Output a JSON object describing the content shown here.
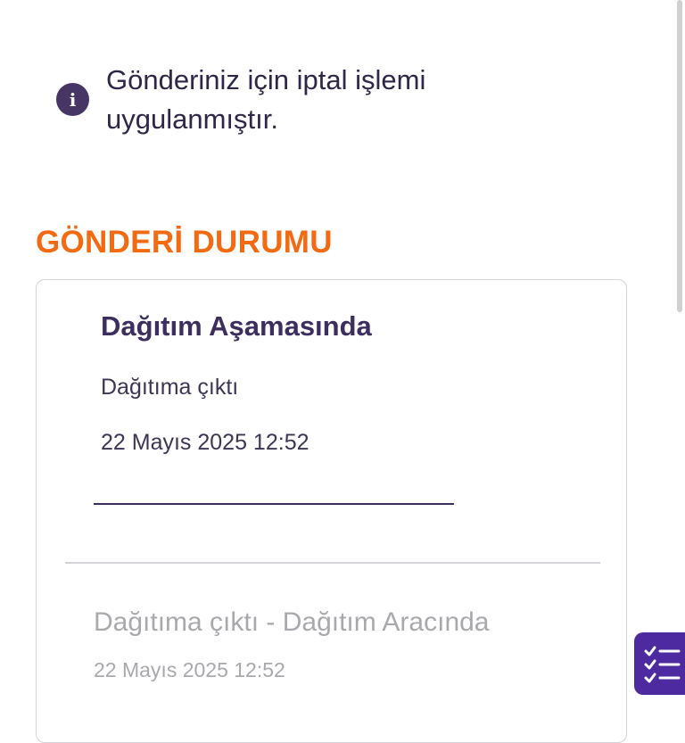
{
  "info_banner": {
    "icon": "info-icon",
    "icon_glyph": "i",
    "text": "Gönderiniz için iptal işlemi uygulanmıştır."
  },
  "section": {
    "title": "GÖNDERİ DURUMU"
  },
  "status_card": {
    "current": {
      "title": "Dağıtım Aşamasında",
      "description": "Dağıtıma çıktı",
      "datetime": "22 Mayıs 2025 12:52"
    },
    "history": [
      {
        "title": "Dağıtıma çıktı - Dağıtım Aracında",
        "datetime": "22 Mayıs 2025 12:52"
      }
    ]
  },
  "fab": {
    "icon": "checklist-icon",
    "color": "#4e2aa1"
  },
  "colors": {
    "accent_orange": "#f26a12",
    "primary_purple": "#3d2e60",
    "muted_gray": "#a9a9ad"
  }
}
